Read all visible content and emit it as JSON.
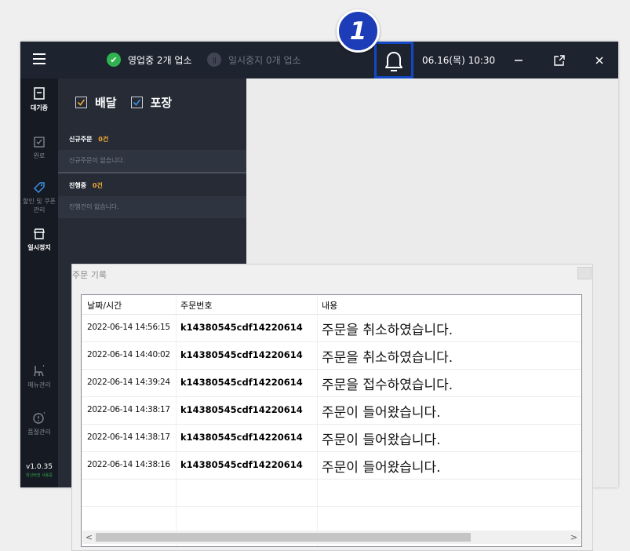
{
  "topbar": {
    "status_open": "영업중 2개 업소",
    "status_paused": "일시중지 0개 업소",
    "datetime": "06.16(목) 10:30"
  },
  "marker": {
    "number": "1"
  },
  "sidebar": {
    "items": [
      {
        "label": "대기중"
      },
      {
        "label": "완료"
      },
      {
        "label": "할인 및 쿠폰관리"
      },
      {
        "label": "일시정지"
      },
      {
        "label": "메뉴관리"
      },
      {
        "label": "품절관리"
      }
    ],
    "version": "v1.0.35",
    "version_note": "최신버전 사용중"
  },
  "orders_panel": {
    "filter_delivery": "배달",
    "filter_pickup": "포장",
    "new_orders_title": "신규주문",
    "new_orders_count": "0건",
    "new_orders_empty": "신규주문이 없습니다.",
    "in_progress_title": "진행중",
    "in_progress_count": "0건",
    "in_progress_empty": "진행건이 없습니다."
  },
  "dialog": {
    "title": "주문 기록",
    "columns": [
      "날짜/시간",
      "주문번호",
      "내용"
    ],
    "rows": [
      {
        "datetime": "2022-06-14 14:56:15",
        "order_no": "k14380545cdf14220614",
        "content": "주문을 취소하였습니다."
      },
      {
        "datetime": "2022-06-14 14:40:02",
        "order_no": "k14380545cdf14220614",
        "content": "주문을 취소하였습니다."
      },
      {
        "datetime": "2022-06-14 14:39:24",
        "order_no": "k14380545cdf14220614",
        "content": "주문을 접수하였습니다."
      },
      {
        "datetime": "2022-06-14 14:38:17",
        "order_no": "k14380545cdf14220614",
        "content": "주문이 들어왔습니다."
      },
      {
        "datetime": "2022-06-14 14:38:17",
        "order_no": "k14380545cdf14220614",
        "content": "주문이 들어왔습니다."
      },
      {
        "datetime": "2022-06-14 14:38:16",
        "order_no": "k14380545cdf14220614",
        "content": "주문이 들어왔습니다."
      }
    ]
  },
  "colors": {
    "topbar_bg": "#1e2330",
    "sidebar_bg": "#161a22",
    "panel_bg": "#262b36",
    "accent_blue": "#1d3db8",
    "status_green": "#2fb24f",
    "count_orange": "#f0a933"
  }
}
